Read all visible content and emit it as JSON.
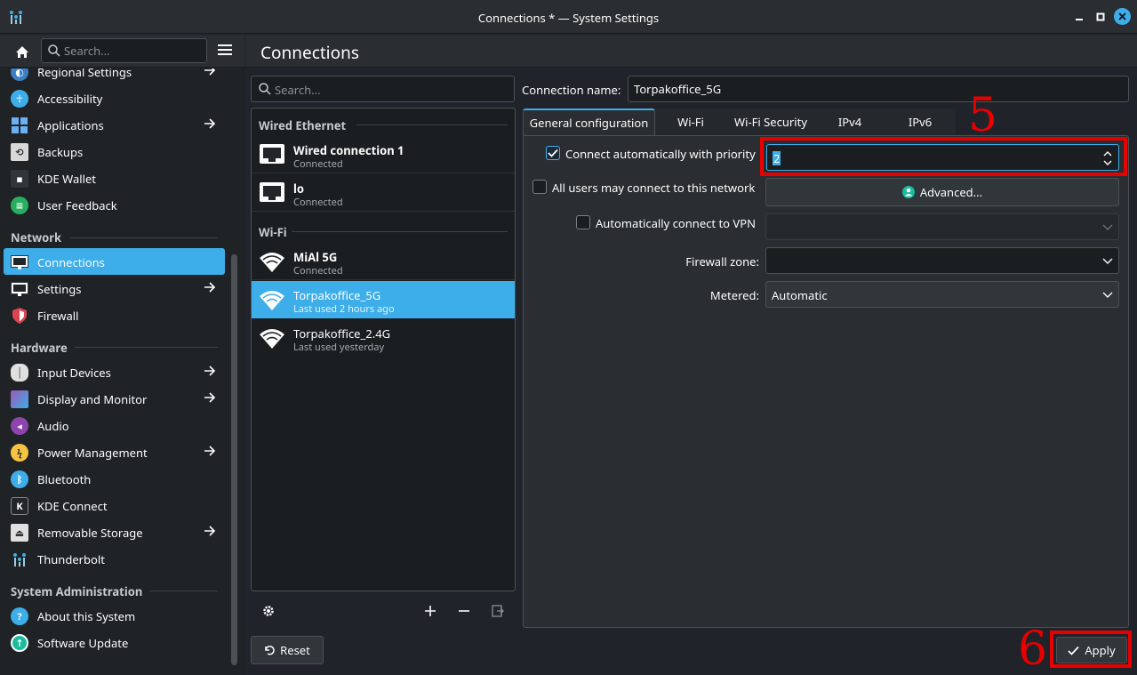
{
  "window": {
    "title": "Connections * — System Settings",
    "icon": "system-settings-icon",
    "controls": [
      "minimize-icon",
      "maximize-icon",
      "close-icon"
    ]
  },
  "sidebar": {
    "search_placeholder": "Search...",
    "items_top": [
      {
        "label": "Regional Settings",
        "icon": "regional-settings-icon",
        "arrow": true
      },
      {
        "label": "Accessibility",
        "icon": "accessibility-icon",
        "arrow": false
      },
      {
        "label": "Applications",
        "icon": "applications-icon",
        "arrow": true
      },
      {
        "label": "Backups",
        "icon": "backups-icon",
        "arrow": false
      },
      {
        "label": "KDE Wallet",
        "icon": "kde-wallet-icon",
        "arrow": false
      },
      {
        "label": "User Feedback",
        "icon": "user-feedback-icon",
        "arrow": false
      }
    ],
    "categories": {
      "network": "Network",
      "hardware": "Hardware",
      "sysadmin": "System Administration"
    },
    "network_items": [
      {
        "label": "Connections",
        "icon": "connections-icon",
        "arrow": false,
        "active": true
      },
      {
        "label": "Settings",
        "icon": "network-settings-icon",
        "arrow": true
      },
      {
        "label": "Firewall",
        "icon": "firewall-icon",
        "arrow": false
      }
    ],
    "hardware_items": [
      {
        "label": "Input Devices",
        "icon": "input-devices-icon",
        "arrow": true
      },
      {
        "label": "Display and Monitor",
        "icon": "display-icon",
        "arrow": true
      },
      {
        "label": "Audio",
        "icon": "audio-icon",
        "arrow": false
      },
      {
        "label": "Power Management",
        "icon": "power-icon",
        "arrow": true
      },
      {
        "label": "Bluetooth",
        "icon": "bluetooth-icon",
        "arrow": false
      },
      {
        "label": "KDE Connect",
        "icon": "kde-connect-icon",
        "arrow": false
      },
      {
        "label": "Removable Storage",
        "icon": "removable-storage-icon",
        "arrow": true
      },
      {
        "label": "Thunderbolt",
        "icon": "thunderbolt-icon",
        "arrow": false
      }
    ],
    "sysadmin_items": [
      {
        "label": "About this System",
        "icon": "about-icon",
        "arrow": false
      },
      {
        "label": "Software Update",
        "icon": "software-update-icon",
        "arrow": false
      }
    ]
  },
  "page": {
    "title": "Connections"
  },
  "connections": {
    "search_placeholder": "Search...",
    "groups": {
      "wired": "Wired Ethernet",
      "wifi": "Wi-Fi"
    },
    "wired": [
      {
        "name": "Wired connection 1",
        "status": "Connected",
        "bold": true
      },
      {
        "name": "lo",
        "status": "Connected",
        "bold": true
      }
    ],
    "wifi": [
      {
        "name": "MiAl 5G",
        "status": "Connected",
        "bold": true
      },
      {
        "name": "Torpakoffice_5G",
        "status": "Last used 2 hours ago",
        "bold": false,
        "selected": true
      },
      {
        "name": "Torpakoffice_2.4G",
        "status": "Last used yesterday",
        "bold": false
      }
    ],
    "tools": [
      "configure-icon",
      "add-icon",
      "remove-icon",
      "export-icon"
    ],
    "reset_label": "Reset"
  },
  "details": {
    "connection_name_label": "Connection name:",
    "connection_name_value": "Torpakoffice_5G",
    "tabs": [
      "General configuration",
      "Wi-Fi",
      "Wi-Fi Security",
      "IPv4",
      "IPv6"
    ],
    "active_tab": 0,
    "general": {
      "auto_connect_label": "Connect automatically with priority",
      "auto_connect_checked": true,
      "priority_value": "2",
      "all_users_label": "All users may connect to this network",
      "all_users_checked": false,
      "advanced_label": "Advanced...",
      "vpn_label": "Automatically connect to VPN",
      "vpn_checked": false,
      "vpn_value": "",
      "firewall_label": "Firewall zone:",
      "firewall_value": "",
      "metered_label": "Metered:",
      "metered_value": "Automatic"
    },
    "apply_label": "Apply"
  },
  "annotations": {
    "step5": "5",
    "step6": "6",
    "color": "#e80000"
  },
  "colors": {
    "accent": "#3daee9",
    "background": "#202326",
    "panel": "#2a2e32",
    "field": "#1b1e20"
  }
}
